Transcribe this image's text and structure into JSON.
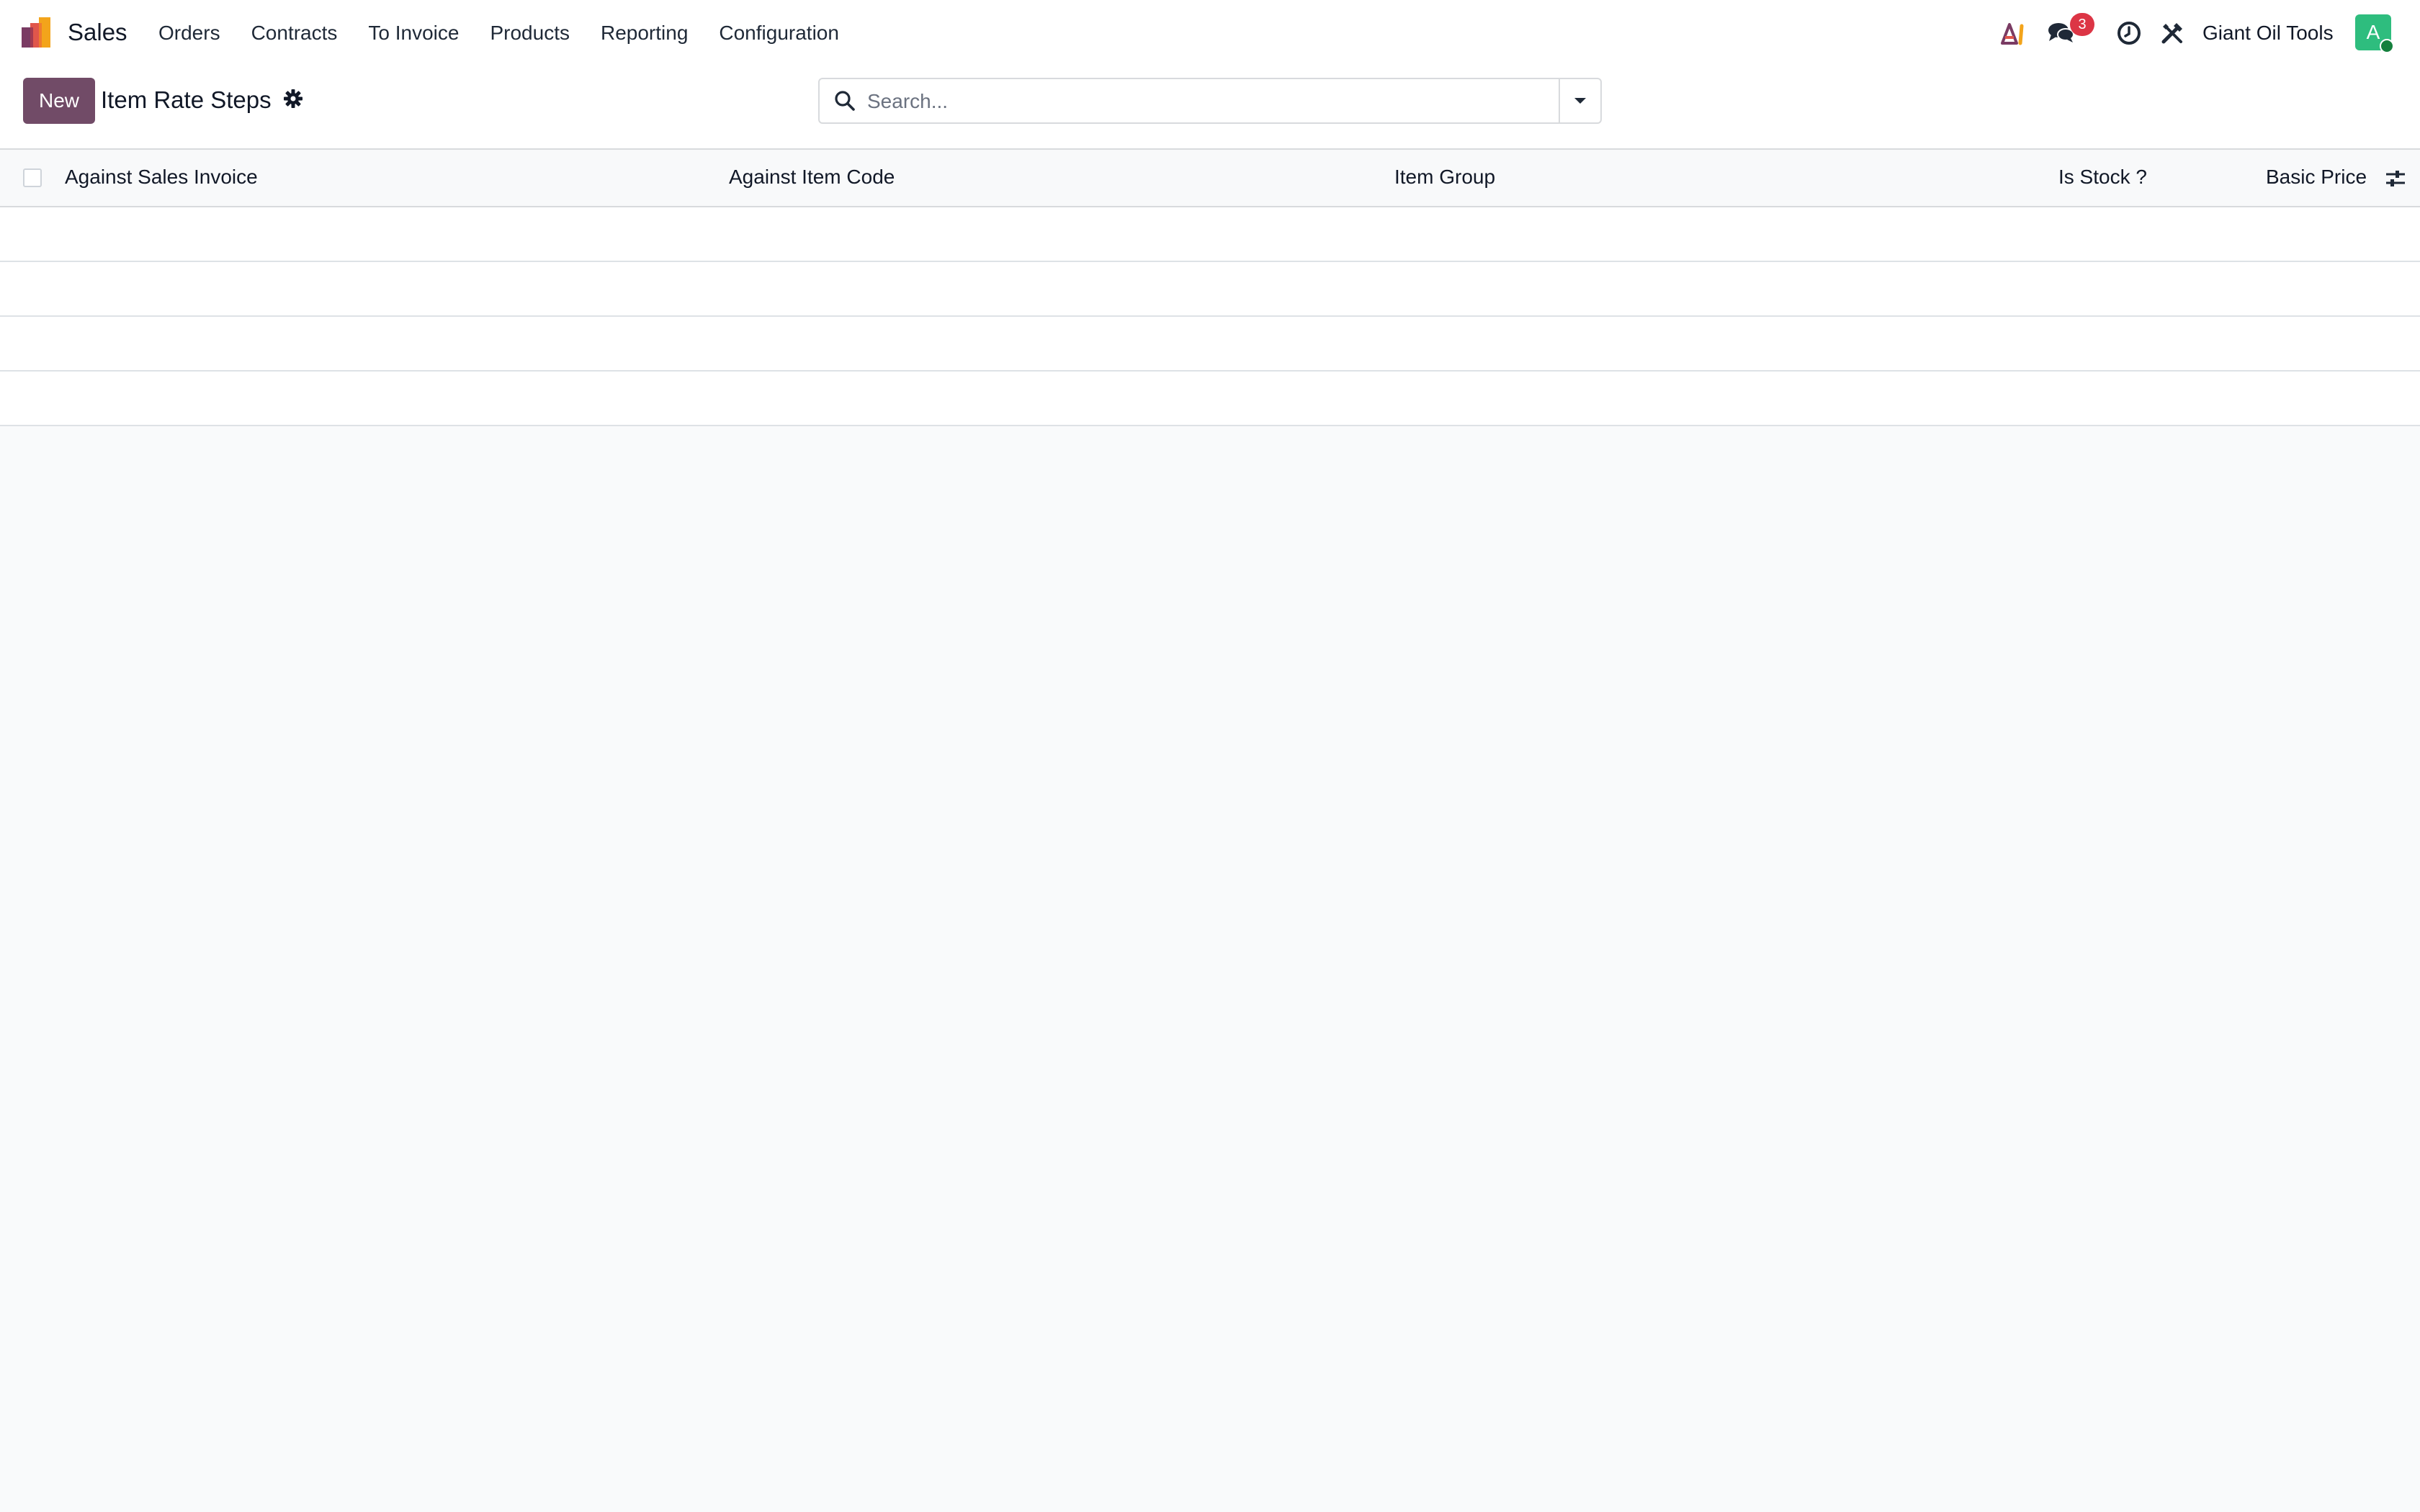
{
  "navbar": {
    "app_name": "Sales",
    "menu": [
      {
        "label": "Orders"
      },
      {
        "label": "Contracts"
      },
      {
        "label": "To Invoice"
      },
      {
        "label": "Products"
      },
      {
        "label": "Reporting"
      },
      {
        "label": "Configuration"
      }
    ],
    "messages_badge": "3",
    "company": "Giant Oil Tools",
    "avatar_initial": "A"
  },
  "control_panel": {
    "new_label": "New",
    "title": "Item Rate Steps",
    "search_placeholder": "Search..."
  },
  "list": {
    "columns": [
      {
        "label": "Against Sales Invoice"
      },
      {
        "label": "Against Item Code"
      },
      {
        "label": "Item Group"
      },
      {
        "label": "Is Stock ?"
      },
      {
        "label": "Basic Price"
      }
    ],
    "rows": []
  },
  "colors": {
    "brand": "#714b67",
    "badge": "#dc3545",
    "avatar": "#2ebd7e"
  }
}
